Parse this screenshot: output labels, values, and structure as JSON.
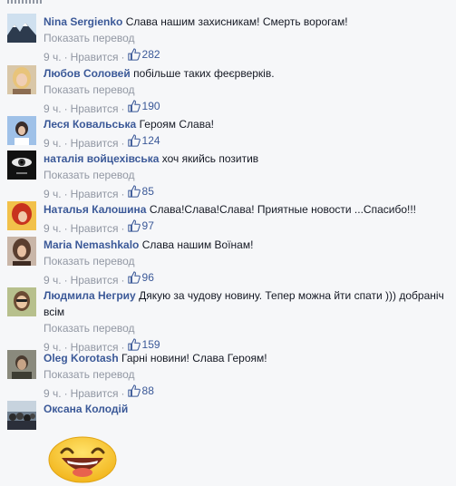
{
  "comments": [
    {
      "author": "Nina Sergienko",
      "text": "Слава нашим захисникам! Смерть ворогам!",
      "translate": "Показать перевод",
      "time": "9 ч.",
      "like_label": "Нравится",
      "likes": "282",
      "avatar": "landscape-mountains"
    },
    {
      "author": "Любов Соловей",
      "text": "побільше таких феєрверків.",
      "translate": "Показать перевод",
      "time": "9 ч.",
      "like_label": "Нравится",
      "likes": "190",
      "avatar": "blonde-woman"
    },
    {
      "author": "Леся Ковальська",
      "text": "Героям Слава!",
      "translate": "",
      "time": "9 ч.",
      "like_label": "Нравится",
      "likes": "124",
      "avatar": "woman-blue-background"
    },
    {
      "author": "наталія войцехівська",
      "text": "хоч якийсь позитив",
      "translate": "Показать перевод",
      "time": "9 ч.",
      "like_label": "Нравится",
      "likes": "85",
      "avatar": "eye-closeup"
    },
    {
      "author": "Наталья Калошина",
      "text": "Слава!Слава!Слава! Приятные новости ...Спасибо!!!",
      "translate": "",
      "time": "9 ч.",
      "like_label": "Нравится",
      "likes": "97",
      "avatar": "red-haired-woman"
    },
    {
      "author": "Maria Nemashkalo",
      "text": "Слава нашим Воїнам!",
      "translate": "Показать перевод",
      "time": "9 ч.",
      "like_label": "Нравится",
      "likes": "96",
      "avatar": "woman-portrait"
    },
    {
      "author": "Людмила Негриу",
      "text": "Дякую за чудову новину. Тепер можна йти спати ))) добраніч всім",
      "translate": "Показать перевод",
      "time": "9 ч.",
      "like_label": "Нравится",
      "likes": "159",
      "avatar": "woman-sunglasses"
    },
    {
      "author": "Oleg Korotash",
      "text": "Гарні новини! Слава Героям!",
      "translate": "Показать перевод",
      "time": "9 ч.",
      "like_label": "Нравится",
      "likes": "88",
      "avatar": "man-portrait"
    },
    {
      "author": "Оксана Колодій",
      "text": "",
      "translate": "",
      "time": "",
      "like_label": "",
      "likes": "",
      "avatar": "crowd-photo"
    }
  ],
  "colors": {
    "link": "#3b5998",
    "meta": "#9197a3",
    "text": "#141823",
    "background": "#f6f7f9"
  },
  "icons": {
    "like": "thumbs-up-icon",
    "sticker": "laughing-smiley-sticker"
  }
}
